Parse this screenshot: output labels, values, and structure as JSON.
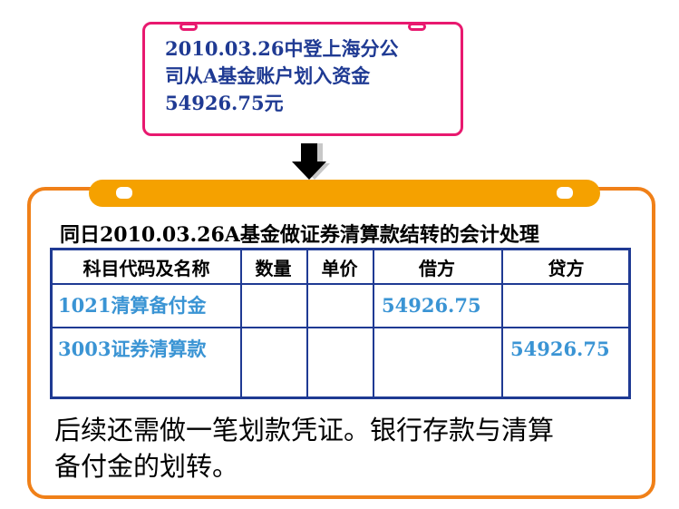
{
  "top_box": {
    "lines": [
      "2010.03.26中登上海分公",
      "司从A基金账户划入资金",
      "54926.75元"
    ]
  },
  "subtitle": "同日2010.03.26A基金做证券清算款结转的会计处理",
  "table": {
    "headers": [
      "科目代码及名称",
      "数量",
      "单价",
      "借方",
      "贷方"
    ],
    "rows": [
      {
        "account": "1021清算备付金",
        "qty": "",
        "price": "",
        "debit": "54926.75",
        "credit": ""
      },
      {
        "account": "3003证券清算款",
        "qty": "",
        "price": "",
        "debit": "",
        "credit": "54926.75"
      }
    ]
  },
  "footer": {
    "lines": [
      "后续还需做一笔划款凭证。银行存款与清算",
      "备付金的划转。"
    ]
  },
  "colors": {
    "pink_border": "#e8196f",
    "orange_frame": "#f08018",
    "banner": "#f5a100",
    "table_border": "#1f3a93",
    "cell_text": "#3a94d4"
  }
}
